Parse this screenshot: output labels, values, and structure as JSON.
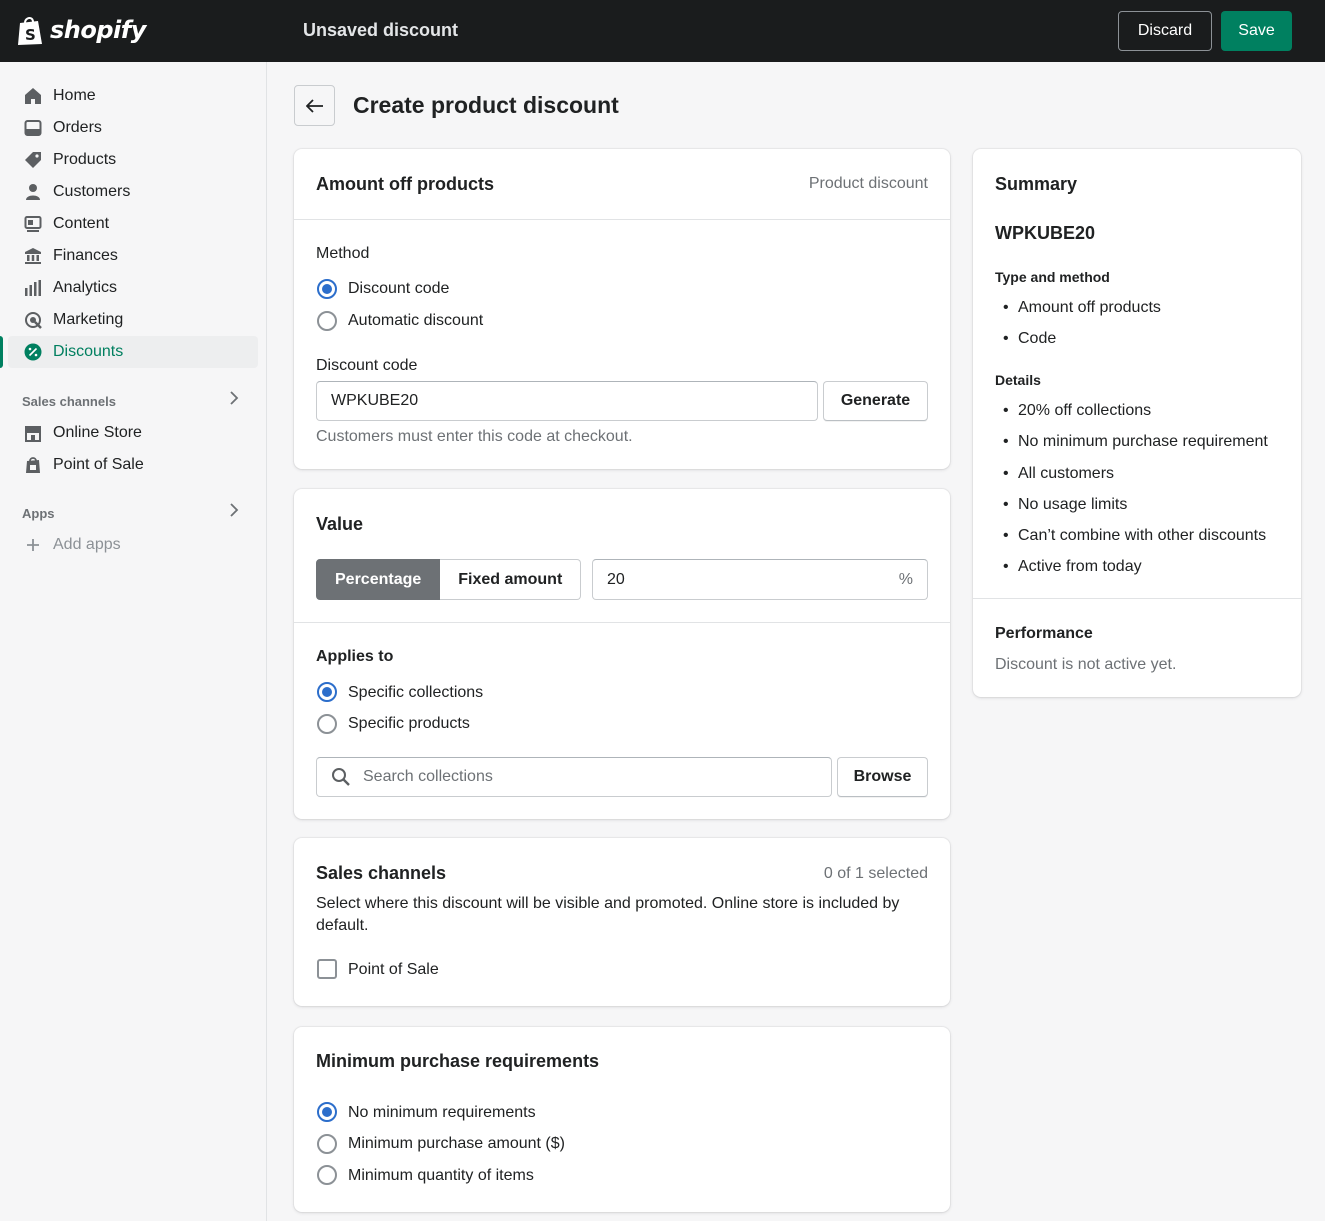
{
  "topbar": {
    "brand": "shopify",
    "title": "Unsaved discount",
    "discard_label": "Discard",
    "save_label": "Save"
  },
  "sidebar": {
    "items": [
      {
        "label": "Home",
        "icon": "home-icon"
      },
      {
        "label": "Orders",
        "icon": "orders-icon"
      },
      {
        "label": "Products",
        "icon": "tag-icon"
      },
      {
        "label": "Customers",
        "icon": "person-icon"
      },
      {
        "label": "Content",
        "icon": "content-icon"
      },
      {
        "label": "Finances",
        "icon": "bank-icon"
      },
      {
        "label": "Analytics",
        "icon": "bar-chart-icon"
      },
      {
        "label": "Marketing",
        "icon": "target-icon"
      },
      {
        "label": "Discounts",
        "icon": "discount-icon",
        "active": true
      }
    ],
    "sales_channels_heading": "Sales channels",
    "sales_channels": [
      {
        "label": "Online Store",
        "icon": "store-icon"
      },
      {
        "label": "Point of Sale",
        "icon": "pos-icon"
      }
    ],
    "apps_heading": "Apps",
    "add_apps_label": "Add apps"
  },
  "page": {
    "title": "Create product discount"
  },
  "amount_card": {
    "title": "Amount off products",
    "badge": "Product discount",
    "method_label": "Method",
    "method_options": [
      "Discount code",
      "Automatic discount"
    ],
    "method_selected": "Discount code",
    "code_label": "Discount code",
    "code_value": "WPKUBE20",
    "generate_label": "Generate",
    "help_text": "Customers must enter this code at checkout."
  },
  "value_card": {
    "title": "Value",
    "type_options": [
      "Percentage",
      "Fixed amount"
    ],
    "type_selected": "Percentage",
    "amount_value": "20",
    "amount_suffix": "%",
    "applies_to_label": "Applies to",
    "applies_options": [
      "Specific collections",
      "Specific products"
    ],
    "applies_selected": "Specific collections",
    "search_placeholder": "Search collections",
    "browse_label": "Browse"
  },
  "channels_card": {
    "title": "Sales channels",
    "count_text": "0 of 1 selected",
    "description": "Select where this discount will be visible and promoted. Online store is included by default.",
    "checkbox_label": "Point of Sale",
    "checked": false
  },
  "minimum_card": {
    "title": "Minimum purchase requirements",
    "options": [
      "No minimum requirements",
      "Minimum purchase amount ($)",
      "Minimum quantity of items"
    ],
    "selected": "No minimum requirements"
  },
  "summary": {
    "title": "Summary",
    "code": "WPKUBE20",
    "type_heading": "Type and method",
    "type_items": [
      "Amount off products",
      "Code"
    ],
    "details_heading": "Details",
    "details_items": [
      "20% off collections",
      "No minimum purchase requirement",
      "All customers",
      "No usage limits",
      "Can’t combine with other discounts",
      "Active from today"
    ],
    "performance_heading": "Performance",
    "performance_text": "Discount is not active yet."
  },
  "colors": {
    "topbar": "#1a1c1d",
    "primary": "#008060",
    "selected_radio": "#2c6ecb",
    "active_nav_text": "#007f5f"
  }
}
